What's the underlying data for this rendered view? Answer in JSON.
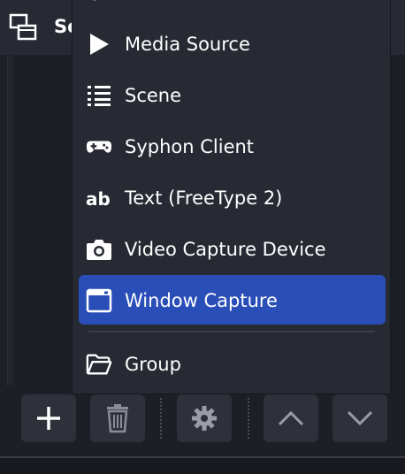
{
  "sources_panel": {
    "title": "So"
  },
  "menu": {
    "items": [
      {
        "label": "Media Source",
        "icon": "play-icon"
      },
      {
        "label": "Scene",
        "icon": "list-icon"
      },
      {
        "label": "Syphon Client",
        "icon": "gamepad-icon"
      },
      {
        "label": "Text (FreeType 2)",
        "icon": "text-ab-icon"
      },
      {
        "label": "Video Capture Device",
        "icon": "camera-icon"
      },
      {
        "label": "Window Capture",
        "icon": "window-icon",
        "selected": true
      },
      {
        "label": "Group",
        "icon": "folder-icon"
      }
    ]
  },
  "toolbar": {
    "buttons": [
      {
        "name": "add",
        "icon": "plus-icon"
      },
      {
        "name": "remove",
        "icon": "trash-icon"
      },
      {
        "name": "properties",
        "icon": "gear-icon"
      },
      {
        "name": "move-up",
        "icon": "chevron-up-icon"
      },
      {
        "name": "move-down",
        "icon": "chevron-down-icon"
      }
    ]
  },
  "colors": {
    "background": "#1d1f26",
    "menu_background": "#272a33",
    "selected_item": "#2a4eb8",
    "button": "#2e313a",
    "text": "#ffffff"
  }
}
